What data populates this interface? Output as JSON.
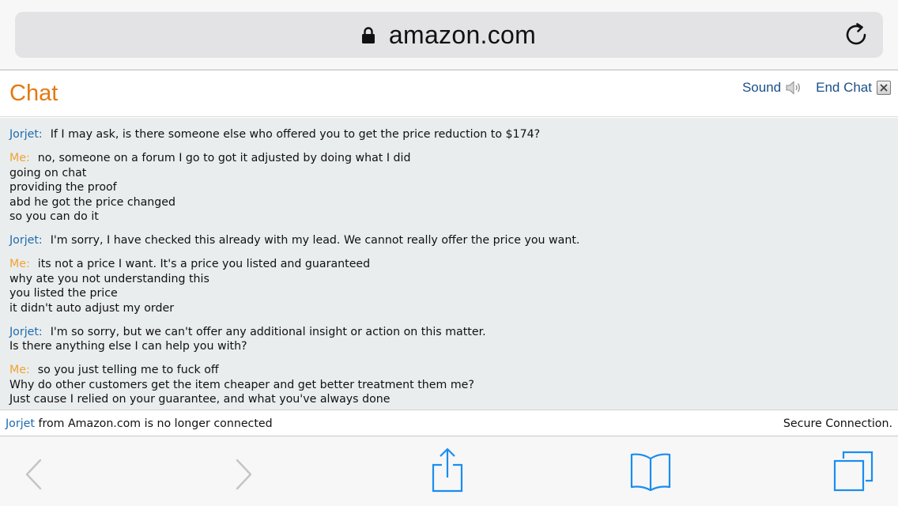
{
  "browser": {
    "url": "amazon.com",
    "icons": {
      "lock": "lock-icon",
      "reload": "reload-icon",
      "back": "chevron-left-icon",
      "forward": "chevron-right-icon",
      "share": "share-icon",
      "bookmarks": "book-icon",
      "tabs": "tabs-icon"
    },
    "accent": "#1a8df0"
  },
  "chat": {
    "title": "Chat",
    "sound_label": "Sound",
    "end_chat_label": "End Chat",
    "title_color": "#e47911",
    "agent_color": "#1c6bb0",
    "me_color": "#f0a233"
  },
  "messages": [
    {
      "who": "Jorjet:",
      "role": "agent",
      "lines": [
        "If I may ask, is there someone else who offered you to get the price reduction to $174?"
      ]
    },
    {
      "who": "Me:",
      "role": "me",
      "lines": [
        "no, someone on a forum I go to got it adjusted by doing what I did",
        "going on chat",
        "providing the proof",
        "abd he got the price changed",
        "so you can do it"
      ]
    },
    {
      "who": "Jorjet:",
      "role": "agent",
      "lines": [
        "I'm sorry, I have checked this already with my lead. We cannot really offer the price you want."
      ]
    },
    {
      "who": "Me:",
      "role": "me",
      "lines": [
        "its not a price I want. It's a price you listed and guaranteed",
        "why ate you not understanding this",
        "you listed the price",
        "it didn't auto adjust my order"
      ]
    },
    {
      "who": "Jorjet:",
      "role": "agent",
      "lines": [
        "I'm so sorry, but we can't offer any additional insight or action on this matter.",
        "Is there anything else I can help you with?"
      ]
    },
    {
      "who": "Me:",
      "role": "me",
      "lines": [
        "so you just telling me to fuck off",
        "Why do other customers get the item cheaper and get better treatment them me?",
        "Just cause I relied on your guarantee, and what you've always done"
      ]
    }
  ],
  "status": {
    "agent_name": "Jorjet",
    "disconnected_text": " from Amazon.com is no longer connected",
    "secure_text": "Secure Connection."
  }
}
